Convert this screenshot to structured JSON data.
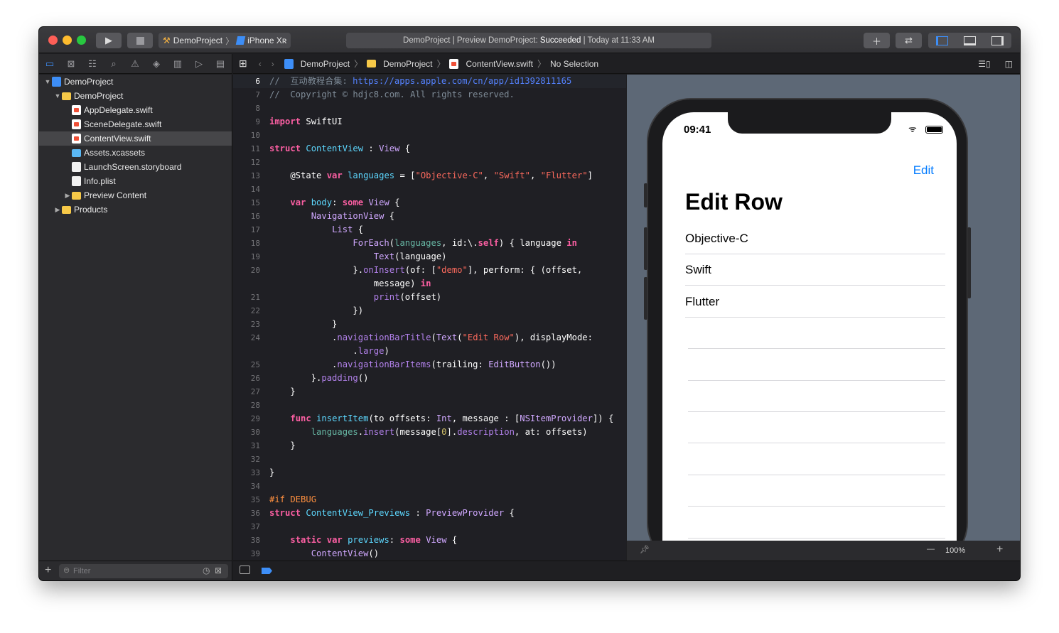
{
  "toolbar": {
    "scheme": "DemoProject",
    "device": "iPhone Xʀ",
    "status_prefix": "DemoProject | Preview DemoProject: ",
    "status_result": "Succeeded",
    "status_suffix": " | Today at 11:33 AM"
  },
  "jumpbar": {
    "items": [
      "DemoProject",
      "DemoProject",
      "ContentView.swift",
      "No Selection"
    ]
  },
  "navigator": {
    "tree": [
      {
        "label": "DemoProject",
        "icon": "proj",
        "depth": 0,
        "disc": "▼"
      },
      {
        "label": "DemoProject",
        "icon": "folder",
        "depth": 1,
        "disc": "▼"
      },
      {
        "label": "AppDelegate.swift",
        "icon": "swift",
        "depth": 2,
        "disc": ""
      },
      {
        "label": "SceneDelegate.swift",
        "icon": "swift",
        "depth": 2,
        "disc": ""
      },
      {
        "label": "ContentView.swift",
        "icon": "swift",
        "depth": 2,
        "disc": "",
        "selected": true
      },
      {
        "label": "Assets.xcassets",
        "icon": "assets",
        "depth": 2,
        "disc": ""
      },
      {
        "label": "LaunchScreen.storyboard",
        "icon": "plain",
        "depth": 2,
        "disc": ""
      },
      {
        "label": "Info.plist",
        "icon": "plain",
        "depth": 2,
        "disc": ""
      },
      {
        "label": "Preview Content",
        "icon": "folder",
        "depth": 2,
        "disc": "▶"
      },
      {
        "label": "Products",
        "icon": "folder",
        "depth": 1,
        "disc": "▶"
      }
    ],
    "filter_placeholder": "Filter"
  },
  "code": [
    {
      "n": "6",
      "cur": true,
      "t": [
        [
          "//  互动教程合集: ",
          "cm"
        ],
        [
          "https://apps.apple.com/cn/app/id1392811165",
          "url"
        ]
      ]
    },
    {
      "n": "7",
      "t": [
        [
          "//  Copyright © hdjc8.com. All rights reserved.",
          "cm"
        ]
      ]
    },
    {
      "n": "8",
      "t": []
    },
    {
      "n": "9",
      "t": [
        [
          "import",
          "kw"
        ],
        [
          " SwiftUI",
          "pl"
        ]
      ]
    },
    {
      "n": "10",
      "t": []
    },
    {
      "n": "11",
      "t": [
        [
          "struct",
          "kw"
        ],
        [
          " ",
          "pl"
        ],
        [
          "ContentView",
          "dt"
        ],
        [
          " : ",
          "pl"
        ],
        [
          "View",
          "ty"
        ],
        [
          " {",
          "pl"
        ]
      ]
    },
    {
      "n": "12",
      "t": []
    },
    {
      "n": "13",
      "t": [
        [
          "    @State ",
          "pl"
        ],
        [
          "var",
          "kw"
        ],
        [
          " ",
          "pl"
        ],
        [
          "languages",
          "dt"
        ],
        [
          " = [",
          "pl"
        ],
        [
          "\"Objective-C\"",
          "str"
        ],
        [
          ", ",
          "pl"
        ],
        [
          "\"Swift\"",
          "str"
        ],
        [
          ", ",
          "pl"
        ],
        [
          "\"Flutter\"",
          "str"
        ],
        [
          "]",
          "pl"
        ]
      ]
    },
    {
      "n": "14",
      "t": []
    },
    {
      "n": "15",
      "t": [
        [
          "    ",
          "pl"
        ],
        [
          "var",
          "kw"
        ],
        [
          " ",
          "pl"
        ],
        [
          "body",
          "dt"
        ],
        [
          ": ",
          "pl"
        ],
        [
          "some",
          "kw"
        ],
        [
          " ",
          "pl"
        ],
        [
          "View",
          "ty"
        ],
        [
          " {",
          "pl"
        ]
      ]
    },
    {
      "n": "16",
      "t": [
        [
          "        ",
          "pl"
        ],
        [
          "NavigationView",
          "ty"
        ],
        [
          " {",
          "pl"
        ]
      ]
    },
    {
      "n": "17",
      "t": [
        [
          "            ",
          "pl"
        ],
        [
          "List",
          "ty"
        ],
        [
          " {",
          "pl"
        ]
      ]
    },
    {
      "n": "18",
      "t": [
        [
          "                ",
          "pl"
        ],
        [
          "ForEach",
          "ty"
        ],
        [
          "(",
          "pl"
        ],
        [
          "languages",
          "id"
        ],
        [
          ", id:\\.",
          "pl"
        ],
        [
          "self",
          "kw"
        ],
        [
          ") { language ",
          "pl"
        ],
        [
          "in",
          "kw"
        ]
      ]
    },
    {
      "n": "19",
      "t": [
        [
          "                    ",
          "pl"
        ],
        [
          "Text",
          "ty"
        ],
        [
          "(language)",
          "pl"
        ]
      ]
    },
    {
      "n": "20",
      "t": [
        [
          "                }.",
          "pl"
        ],
        [
          "onInsert",
          "fn"
        ],
        [
          "(of: [",
          "pl"
        ],
        [
          "\"demo\"",
          "str"
        ],
        [
          "], perform: { (offset,",
          "pl"
        ]
      ]
    },
    {
      "n": "",
      "t": [
        [
          "                    message) ",
          "pl"
        ],
        [
          "in",
          "kw"
        ]
      ]
    },
    {
      "n": "21",
      "t": [
        [
          "                    ",
          "pl"
        ],
        [
          "print",
          "fn"
        ],
        [
          "(offset)",
          "pl"
        ]
      ]
    },
    {
      "n": "22",
      "t": [
        [
          "                })",
          "pl"
        ]
      ]
    },
    {
      "n": "23",
      "t": [
        [
          "            }",
          "pl"
        ]
      ]
    },
    {
      "n": "24",
      "t": [
        [
          "            .",
          "pl"
        ],
        [
          "navigationBarTitle",
          "fn"
        ],
        [
          "(",
          "pl"
        ],
        [
          "Text",
          "ty"
        ],
        [
          "(",
          "pl"
        ],
        [
          "\"Edit Row\"",
          "str"
        ],
        [
          "), displayMode:",
          "pl"
        ]
      ]
    },
    {
      "n": "",
      "t": [
        [
          "                .",
          "pl"
        ],
        [
          "large",
          "fn"
        ],
        [
          ")",
          "pl"
        ]
      ]
    },
    {
      "n": "25",
      "t": [
        [
          "            .",
          "pl"
        ],
        [
          "navigationBarItems",
          "fn"
        ],
        [
          "(trailing: ",
          "pl"
        ],
        [
          "EditButton",
          "ty"
        ],
        [
          "())",
          "pl"
        ]
      ]
    },
    {
      "n": "26",
      "t": [
        [
          "        }.",
          "pl"
        ],
        [
          "padding",
          "fn"
        ],
        [
          "()",
          "pl"
        ]
      ]
    },
    {
      "n": "27",
      "t": [
        [
          "    }",
          "pl"
        ]
      ]
    },
    {
      "n": "28",
      "t": []
    },
    {
      "n": "29",
      "t": [
        [
          "    ",
          "pl"
        ],
        [
          "func",
          "kw"
        ],
        [
          " ",
          "pl"
        ],
        [
          "insertItem",
          "dt"
        ],
        [
          "(to offsets: ",
          "pl"
        ],
        [
          "Int",
          "ty"
        ],
        [
          ", message : [",
          "pl"
        ],
        [
          "NSItemProvider",
          "ty"
        ],
        [
          "]) {",
          "pl"
        ]
      ]
    },
    {
      "n": "30",
      "t": [
        [
          "        ",
          "pl"
        ],
        [
          "languages",
          "id"
        ],
        [
          ".",
          "pl"
        ],
        [
          "insert",
          "fn"
        ],
        [
          "(message[",
          "pl"
        ],
        [
          "0",
          "num"
        ],
        [
          "].",
          "pl"
        ],
        [
          "description",
          "fn"
        ],
        [
          ", at: offsets)",
          "pl"
        ]
      ]
    },
    {
      "n": "31",
      "t": [
        [
          "    }",
          "pl"
        ]
      ]
    },
    {
      "n": "32",
      "t": []
    },
    {
      "n": "33",
      "t": [
        [
          "}",
          "pl"
        ]
      ]
    },
    {
      "n": "34",
      "t": []
    },
    {
      "n": "35",
      "t": [
        [
          "#if DEBUG",
          "pp"
        ]
      ]
    },
    {
      "n": "36",
      "t": [
        [
          "struct",
          "kw"
        ],
        [
          " ",
          "pl"
        ],
        [
          "ContentView_Previews",
          "dt"
        ],
        [
          " : ",
          "pl"
        ],
        [
          "PreviewProvider",
          "ty"
        ],
        [
          " {",
          "pl"
        ]
      ]
    },
    {
      "n": "37",
      "t": []
    },
    {
      "n": "38",
      "t": [
        [
          "    ",
          "pl"
        ],
        [
          "static",
          "kw"
        ],
        [
          " ",
          "pl"
        ],
        [
          "var",
          "kw"
        ],
        [
          " ",
          "pl"
        ],
        [
          "previews",
          "dt"
        ],
        [
          ": ",
          "pl"
        ],
        [
          "some",
          "kw"
        ],
        [
          " ",
          "pl"
        ],
        [
          "View",
          "ty"
        ],
        [
          " {",
          "pl"
        ]
      ]
    },
    {
      "n": "39",
      "t": [
        [
          "        ",
          "pl"
        ],
        [
          "ContentView",
          "ty"
        ],
        [
          "()",
          "pl"
        ]
      ]
    }
  ],
  "preview": {
    "time": "09:41",
    "edit_button": "Edit",
    "title": "Edit Row",
    "rows": [
      "Objective-C",
      "Swift",
      "Flutter"
    ],
    "zoom": "100%"
  }
}
